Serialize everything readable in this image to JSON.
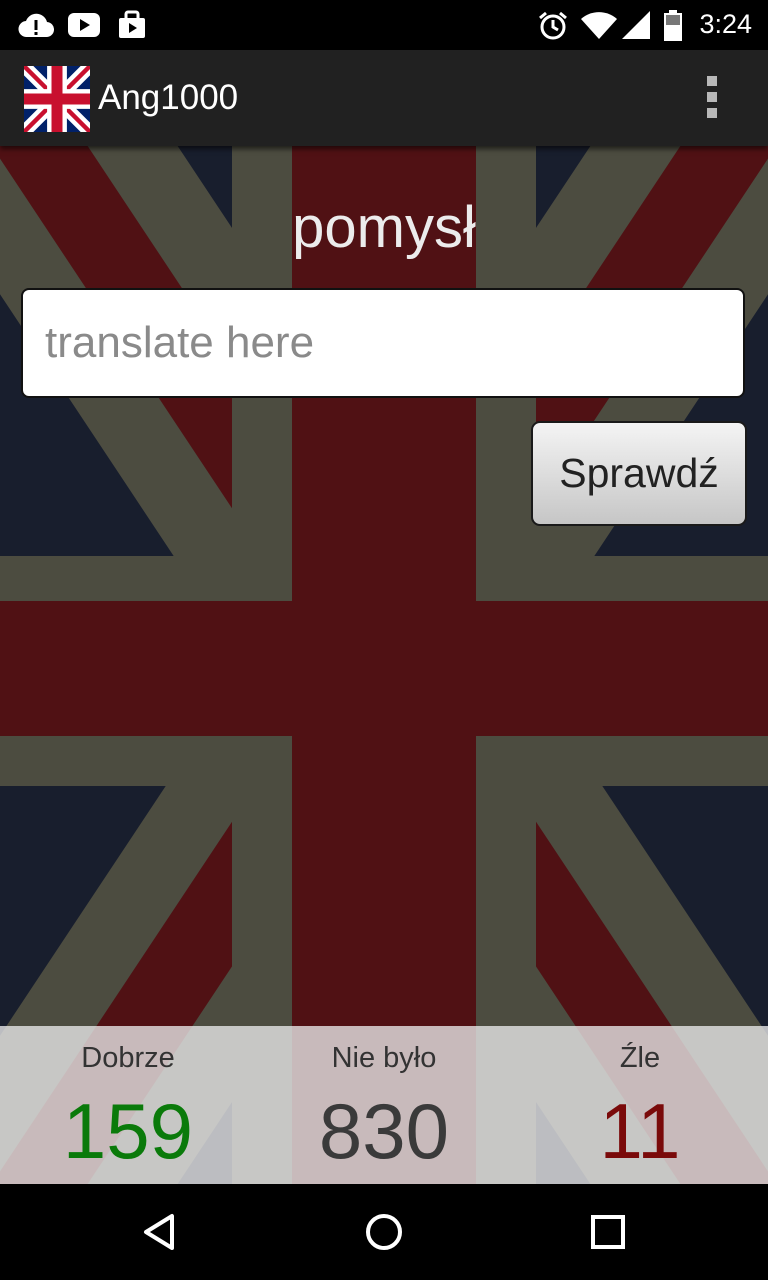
{
  "status_bar": {
    "time": "3:24",
    "left_icons": [
      "cloud-alert-icon",
      "youtube-icon",
      "bag-icon"
    ],
    "right_icons": [
      "alarm-icon",
      "wifi-icon",
      "signal-icon",
      "battery-icon"
    ]
  },
  "app_bar": {
    "title": "Ang1000",
    "logo": "uk-flag-icon",
    "menu": "overflow-menu-icon"
  },
  "quiz": {
    "word": "pomysł",
    "input_placeholder": "translate here",
    "input_value": "",
    "check_label": "Sprawdź"
  },
  "stats": {
    "correct_label": "Dobrze",
    "correct_value": "159",
    "remaining_label": "Nie było",
    "remaining_value": "830",
    "wrong_label": "Źle",
    "wrong_value": "11"
  },
  "colors": {
    "correct": "#0a7a0a",
    "remaining": "#3a3a3a",
    "wrong": "#7a0a0a",
    "app_bar": "#212121",
    "flag_blue": "#1d2436",
    "flag_red": "#5e1418",
    "flag_white": "#5a5a4c"
  },
  "nav_bar": {
    "icons": [
      "back-icon",
      "home-icon",
      "recents-icon"
    ]
  }
}
